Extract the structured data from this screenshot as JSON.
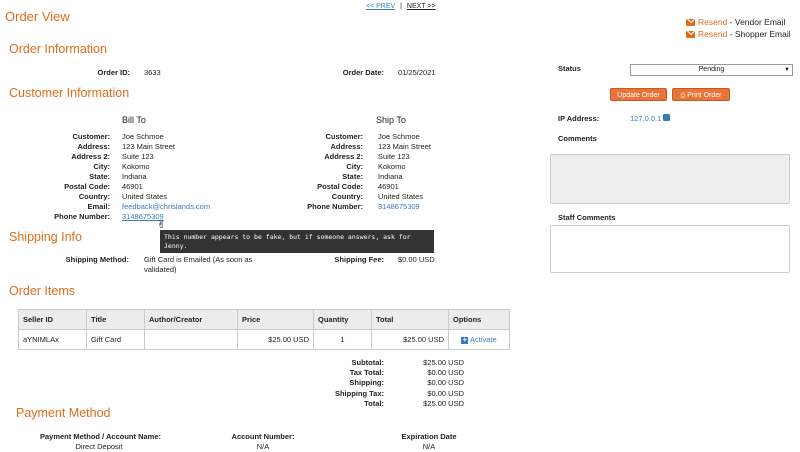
{
  "title": "Order View",
  "nav": {
    "prev": "<< PREV",
    "sep": "|",
    "next": "NEXT >>"
  },
  "resend": [
    {
      "link": "Resend",
      "text": "- Vendor Email"
    },
    {
      "link": "Resend",
      "text": "- Shopper Email"
    }
  ],
  "order_info": {
    "heading": "Order Information",
    "id_label": "Order ID:",
    "id": "3633",
    "date_label": "Order Date:",
    "date": "01/25/2021"
  },
  "customer": {
    "heading": "Customer Information",
    "bill_to": "Bill To",
    "ship_to": "Ship To",
    "labels": {
      "customer": "Customer:",
      "address": "Address:",
      "address2": "Address 2:",
      "city": "City:",
      "state": "State:",
      "postal": "Postal Code:",
      "country": "Country:",
      "email": "Email:",
      "phone": "Phone Number:"
    },
    "bill": {
      "customer": "Joe Schmoe",
      "address": "123 Main Street",
      "address2": "Suite 123",
      "city": "Kokomo",
      "state": "Indiana",
      "postal": "46901",
      "country": "United States",
      "email": "feedback@chrislands.com",
      "phone": "3148675309"
    },
    "ship": {
      "customer": "Joe Schmoe",
      "address": "123 Main Street",
      "address2": "Suite 123",
      "city": "Kokomo",
      "state": "Indiana",
      "postal": "46901",
      "country": "United States",
      "phone": "3148675309"
    }
  },
  "tooltip": "This number appears to be fake, but if someone answers, ask for Jenny.",
  "shipping": {
    "heading": "Shipping Info",
    "method_label": "Shipping Method:",
    "method": "Gift Card is Emailed (As soon as validated)",
    "fee_label": "Shipping Fee:",
    "fee": "$0.00 USD"
  },
  "items": {
    "heading": "Order Items",
    "columns": [
      "Seller ID",
      "Title",
      "Author/Creator",
      "Price",
      "Quantity",
      "Total",
      "Options"
    ],
    "rows": [
      {
        "seller": "aYNIMLAx",
        "title": "Gift Card",
        "author": "",
        "price": "$25.00 USD",
        "qty": "1",
        "total": "$25.00 USD",
        "option": "Activate"
      }
    ]
  },
  "totals": [
    {
      "label": "Subtotal:",
      "value": "$25.00 USD"
    },
    {
      "label": "Tax Total:",
      "value": "$0.00 USD"
    },
    {
      "label": "Shipping:",
      "value": "$0.00 USD"
    },
    {
      "label": "Shipping Tax:",
      "value": "$0.00 USD"
    },
    {
      "label": "Total:",
      "value": "$25.00 USD"
    }
  ],
  "payment": {
    "heading": "Payment Method",
    "method_label": "Payment Method / Account Name:",
    "method": "Direct Deposit",
    "account_label": "Account Number:",
    "account": "N/A",
    "exp_label": "Expiration Date",
    "exp": "N/A"
  },
  "sidebar": {
    "status_label": "Status",
    "status_value": "Pending",
    "update_btn": "Update Order",
    "print_btn": "Print Order",
    "ip_label": "IP Address:",
    "ip": "127.0.0.1",
    "comments_label": "Comments",
    "staff_comments_label": "Staff Comments"
  },
  "colors": {
    "accent": "#e06c1a",
    "link": "#3a7bbf",
    "button": "#e8743a"
  }
}
